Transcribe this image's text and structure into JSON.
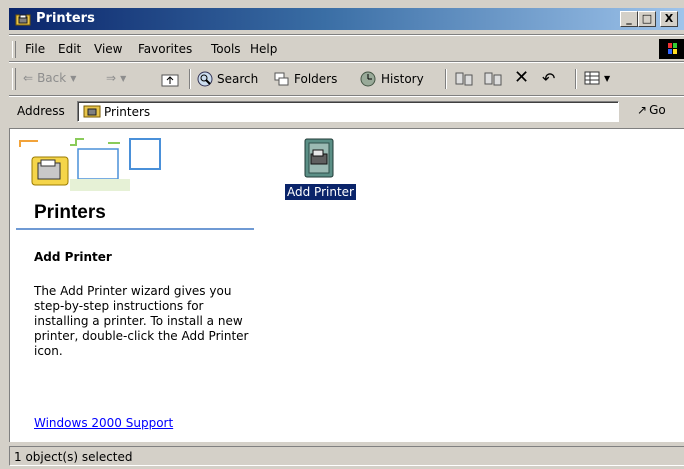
{
  "window": {
    "title": "Printers",
    "controls": {
      "minimize": "_",
      "maximize": "□",
      "close": "X"
    }
  },
  "menu": {
    "items": [
      {
        "label": "File"
      },
      {
        "label": "Edit"
      },
      {
        "label": "View"
      },
      {
        "label": "Favorites"
      },
      {
        "label": "Tools"
      },
      {
        "label": "Help"
      }
    ]
  },
  "toolbar": {
    "back": "Back",
    "search": "Search",
    "folders": "Folders",
    "history": "History"
  },
  "address": {
    "label": "Address",
    "value": "Printers",
    "go": "Go"
  },
  "webview": {
    "heading": "Printers",
    "section_title": "Add Printer",
    "section_desc": "The Add Printer wizard gives you step-by-step instructions for installing a printer. To install a new printer, double-click the Add Printer icon.",
    "support_link": "Windows 2000 Support"
  },
  "items": [
    {
      "label": "Add Printer",
      "selected": true
    }
  ],
  "status": {
    "text": "1 object(s) selected"
  },
  "colors": {
    "title_start": "#0a246a",
    "title_end": "#a6caf0",
    "chrome": "#d4d0c8",
    "selection": "#0a246a",
    "link": "#0000ff"
  }
}
